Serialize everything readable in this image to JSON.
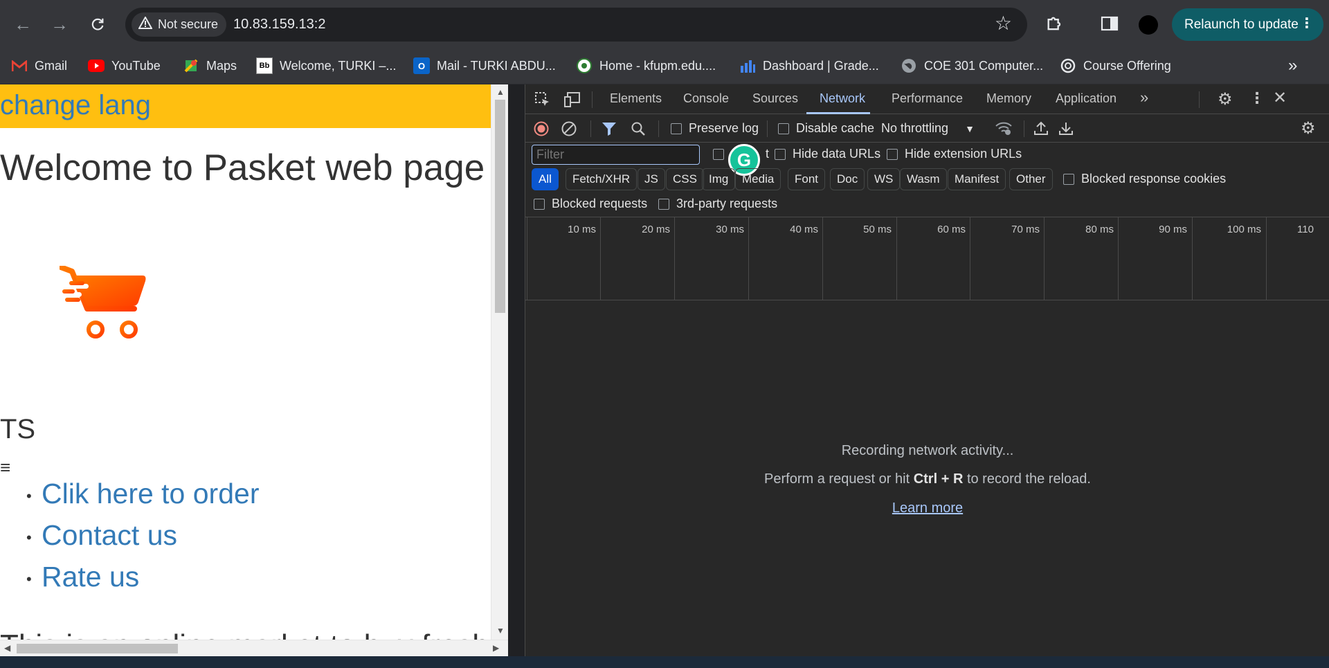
{
  "browser": {
    "security_label": "Not secure",
    "url": "10.83.159.13:2",
    "relaunch_label": "Relaunch to update",
    "bookmarks": [
      {
        "label": "Gmail",
        "icon": "gmail-icon"
      },
      {
        "label": "YouTube",
        "icon": "youtube-icon"
      },
      {
        "label": "Maps",
        "icon": "maps-icon"
      },
      {
        "label": "Welcome, TURKI –...",
        "icon": "blackboard-icon"
      },
      {
        "label": "Mail - TURKI ABDU...",
        "icon": "outlook-icon"
      },
      {
        "label": "Home - kfupm.edu....",
        "icon": "kfupm-icon"
      },
      {
        "label": "Dashboard | Grade...",
        "icon": "bar-chart-icon"
      },
      {
        "label": "COE 301 Computer...",
        "icon": "globe-icon"
      },
      {
        "label": "Course Offering",
        "icon": "course-offering-icon"
      }
    ]
  },
  "page": {
    "change_lang": "change lang",
    "welcome": "Welcome to Pasket web page",
    "ts": "TS",
    "hamburger": "≡",
    "menu": [
      "Clik here to order",
      "Contact us",
      "Rate us"
    ],
    "cut_text": "This is an online market to buy fresh fo"
  },
  "devtools": {
    "tabs": [
      "Elements",
      "Console",
      "Sources",
      "Network",
      "Performance",
      "Memory",
      "Application"
    ],
    "active_tab": "Network",
    "preserve_log": "Preserve log",
    "disable_cache": "Disable cache",
    "throttling": "No throttling",
    "filter_placeholder": "Filter",
    "invert_partial": "t",
    "hide_data_urls": "Hide data URLs",
    "hide_extension_urls": "Hide extension URLs",
    "type_filters": [
      "All",
      "Fetch/XHR",
      "JS",
      "CSS",
      "Img",
      "Media",
      "Font",
      "Doc",
      "WS",
      "Wasm",
      "Manifest",
      "Other"
    ],
    "blocked_response_cookies": "Blocked response cookies",
    "blocked_requests": "Blocked requests",
    "third_party_requests": "3rd-party requests",
    "timeline_labels": [
      "10 ms",
      "20 ms",
      "30 ms",
      "40 ms",
      "50 ms",
      "60 ms",
      "70 ms",
      "80 ms",
      "90 ms",
      "100 ms",
      "110"
    ],
    "recording": "Recording network activity...",
    "hint_before": "Perform a request or hit ",
    "hint_keys": "Ctrl + R",
    "hint_after": " to record the reload.",
    "learn_more": "Learn more"
  },
  "colors": {
    "lang_bar": "#ffbf10",
    "link": "#337ab7",
    "relaunch": "#0f5d66",
    "devtools_accent": "#a8c7fa"
  }
}
